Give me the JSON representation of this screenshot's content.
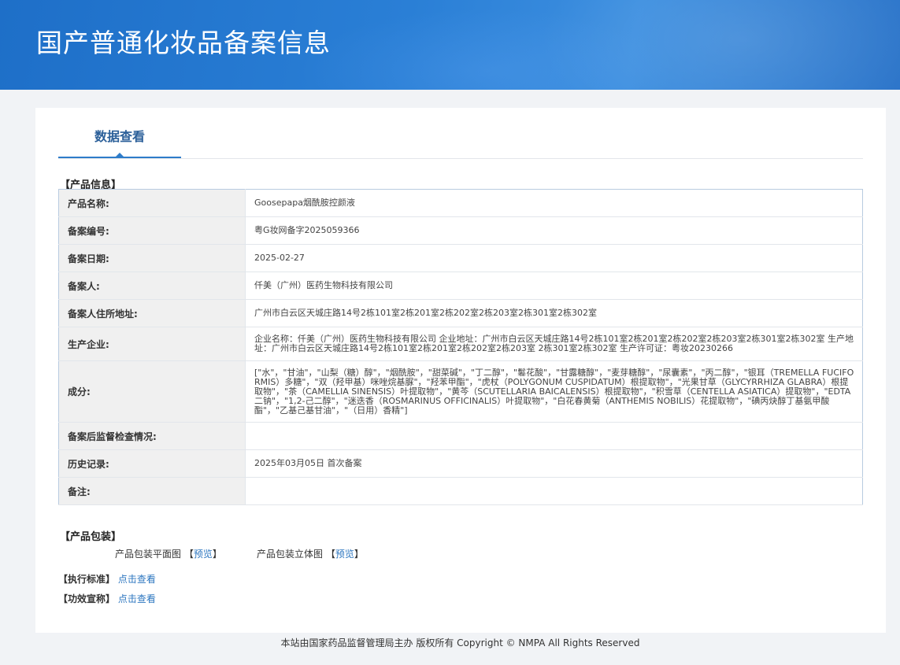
{
  "header": {
    "title": "国产普通化妆品备案信息"
  },
  "tabs": {
    "active_label": "数据查看"
  },
  "product_info": {
    "section_label": "【产品信息】",
    "rows": [
      {
        "key": "产品名称:",
        "value": "Goosepapa烟酰胺控颜液"
      },
      {
        "key": "备案编号:",
        "value": "粤G妆网备字2025059366"
      },
      {
        "key": "备案日期:",
        "value": "2025-02-27"
      },
      {
        "key": "备案人:",
        "value": "仟美（广州）医药生物科技有限公司"
      },
      {
        "key": "备案人住所地址:",
        "value": "广州市白云区天城庄路14号2栋101室2栋201室2栋202室2栋203室2栋301室2栋302室"
      },
      {
        "key": "生产企业:",
        "value": "企业名称：仟美（广州）医药生物科技有限公司 企业地址：广州市白云区天城庄路14号2栋101室2栋201室2栋202室2栋203室2栋301室2栋302室 生产地址：广州市白云区天城庄路14号2栋101室2栋201室2栋202室2栋203室 2栋301室2栋302室 生产许可证：粤妆20230266"
      },
      {
        "key": "成分:",
        "value": "[\"水\"，\"甘油\"，\"山梨（糖）醇\"，\"烟酰胺\"，\"甜菜碱\"，\"丁二醇\"，\"鬈花酸\"，\"甘露糖醇\"，\"麦芽糖醇\"，\"尿囊素\"，\"丙二醇\"，\"银耳（TREMELLA FUCIFORMIS）多糖\"，\"双（羟甲基）咪唑烷基脲\"，\"羟苯甲酯\"，\"虎杖（POLYGONUM CUSPIDATUM）根提取物\"，\"光果甘草（GLYCYRRHIZA GLABRA）根提取物\"，\"茶（CAMELLIA SINENSIS）叶提取物\"，\"黄芩（SCUTELLARIA BAICALENSIS）根提取物\"，\"积雪草（CENTELLA ASIATICA）提取物\"，\"EDTA 二钠\"，\"1,2-己二醇\"，\"迷迭香（ROSMARINUS OFFICINALIS）叶提取物\"，\"白花春黄菊（ANTHEMIS NOBILIS）花提取物\"，\"碘丙炔醇丁基氨甲酸酯\"，\"乙基己基甘油\"，\"（日用）香精\"]"
      },
      {
        "key": "备案后监督检查情况:",
        "value": ""
      },
      {
        "key": "历史记录:",
        "value": "2025年03月05日 首次备案"
      },
      {
        "key": "备注:",
        "value": ""
      }
    ]
  },
  "packaging": {
    "section_label": "【产品包装】",
    "flat_label": "产品包装平面图",
    "flat_preview_open": "【",
    "flat_preview": "预览",
    "flat_preview_close": "】",
    "stereo_label": "产品包装立体图",
    "stereo_preview_open": "【",
    "stereo_preview": "预览",
    "stereo_preview_close": "】"
  },
  "standard": {
    "label": "【执行标准】",
    "link": "点击查看"
  },
  "efficacy": {
    "label": "【功效宣称】",
    "link": "点击查看"
  },
  "footer": {
    "text": "本站由国家药品监督管理局主办 版权所有 Copyright © NMPA All Rights Reserved"
  }
}
